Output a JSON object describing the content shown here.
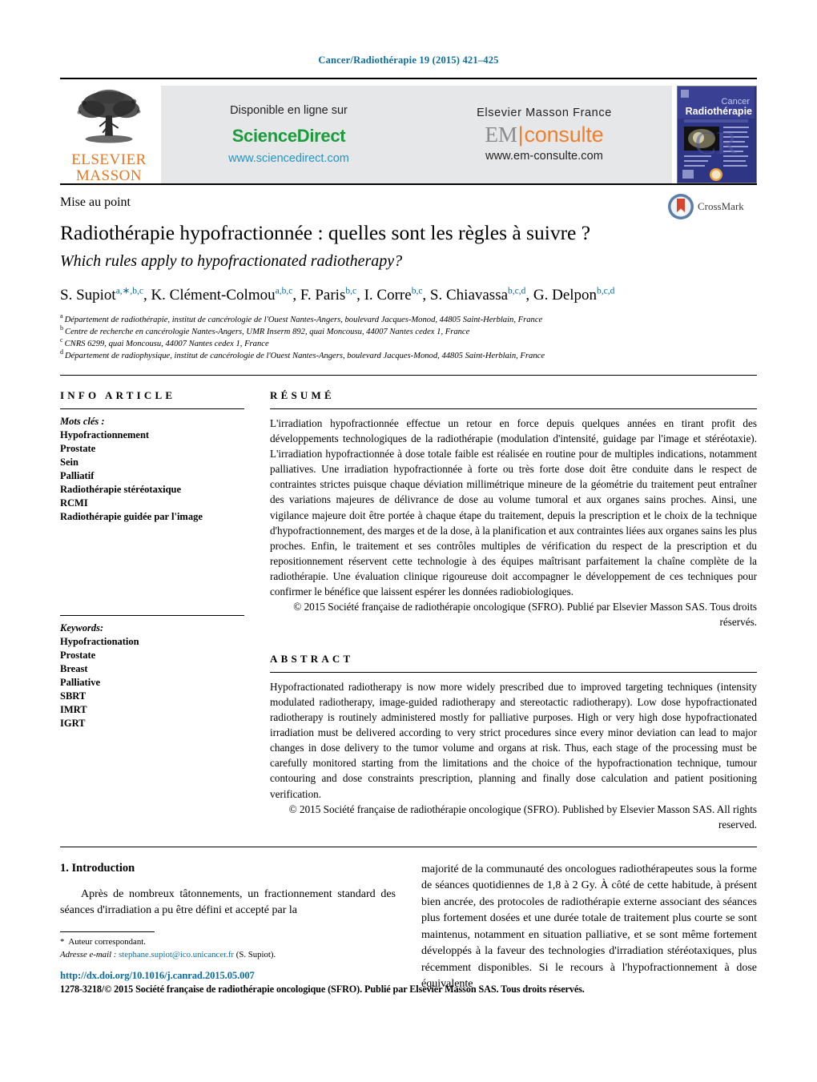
{
  "running_head": "Cancer/Radiothérapie 19 (2015) 421–425",
  "masthead": {
    "publisher_line1": "ELSEVIER",
    "publisher_line2": "MASSON",
    "available_label": "Disponible en ligne sur",
    "sciencedirect_logo": "ScienceDirect",
    "sciencedirect_url": "www.sciencedirect.com",
    "em_label": "Elsevier Masson France",
    "em_logo_grey": "EM",
    "em_logo_orange": "consulte",
    "em_url": "www.em-consulte.com",
    "cover_title_line1": "Cancer",
    "cover_title_line2": "Radiothérapie"
  },
  "article": {
    "type": "Mise au point",
    "title_fr": "Radiothérapie hypofractionnée : quelles sont les règles à suivre ?",
    "title_en": "Which rules apply to hypofractionated radiotherapy?",
    "crossmark_label": "CrossMark",
    "authors": [
      {
        "name": "S. Supiot",
        "sup": "a,∗,b,c",
        "sep": ", "
      },
      {
        "name": "K. Clément-Colmou",
        "sup": "a,b,c",
        "sep": ", "
      },
      {
        "name": "F. Paris",
        "sup": "b,c",
        "sep": ", "
      },
      {
        "name": "I. Corre",
        "sup": "b,c",
        "sep": ", "
      },
      {
        "name": "S. Chiavassa",
        "sup": "b,c,d",
        "sep": ", "
      },
      {
        "name": "G. Delpon",
        "sup": "b,c,d",
        "sep": ""
      }
    ],
    "affiliations": [
      {
        "mark": "a",
        "text": "Département de radiothérapie, institut de cancérologie de l'Ouest Nantes-Angers, boulevard Jacques-Monod, 44805 Saint-Herblain, France"
      },
      {
        "mark": "b",
        "text": "Centre de recherche en cancérologie Nantes-Angers, UMR Inserm 892, quai Moncousu, 44007 Nantes cedex 1, France"
      },
      {
        "mark": "c",
        "text": "CNRS 6299, quai Moncousu, 44007 Nantes cedex 1, France"
      },
      {
        "mark": "d",
        "text": "Département de radiophysique, institut de cancérologie de l'Ouest Nantes-Angers, boulevard Jacques-Monod, 44805 Saint-Herblain, France"
      }
    ]
  },
  "info_article": {
    "heading": "INFO ARTICLE",
    "keywords_title": "Mots clés :",
    "keywords": [
      "Hypofractionnement",
      "Prostate",
      "Sein",
      "Palliatif",
      "Radiothérapie stéréotaxique",
      "RCMI",
      "Radiothérapie guidée par l'image"
    ]
  },
  "keywords_en": {
    "keywords_title": "Keywords:",
    "keywords": [
      "Hypofractionation",
      "Prostate",
      "Breast",
      "Palliative",
      "SBRT",
      "IMRT",
      "IGRT"
    ]
  },
  "resume": {
    "heading": "RÉSUMÉ",
    "text": "L'irradiation hypofractionnée effectue un retour en force depuis quelques années en tirant profit des développements technologiques de la radiothérapie (modulation d'intensité, guidage par l'image et stéréotaxie). L'irradiation hypofractionnée à dose totale faible est réalisée en routine pour de multiples indications, notamment palliatives. Une irradiation hypofractionnée à forte ou très forte dose doit être conduite dans le respect de contraintes strictes puisque chaque déviation millimétrique mineure de la géométrie du traitement peut entraîner des variations majeures de délivrance de dose au volume tumoral et aux organes sains proches. Ainsi, une vigilance majeure doit être portée à chaque étape du traitement, depuis la prescription et le choix de la technique d'hypofractionnement, des marges et de la dose, à la planification et aux contraintes liées aux organes sains les plus proches. Enfin, le traitement et ses contrôles multiples de vérification du respect de la prescription et du repositionnement réservent cette technologie à des équipes maîtrisant parfaitement la chaîne complète de la radiothérapie. Une évaluation clinique rigoureuse doit accompagner le développement de ces techniques pour confirmer le bénéfice que laissent espérer les données radiobiologiques.",
    "copyright": "© 2015 Société française de radiothérapie oncologique (SFRO). Publié par Elsevier Masson SAS. Tous droits réservés."
  },
  "abstract": {
    "heading": "ABSTRACT",
    "text": "Hypofractionated radiotherapy is now more widely prescribed due to improved targeting techniques (intensity modulated radiotherapy, image-guided radiotherapy and stereotactic radiotherapy). Low dose hypofractionated radiotherapy is routinely administered mostly for palliative purposes. High or very high dose hypofractionated irradiation must be delivered according to very strict procedures since every minor deviation can lead to major changes in dose delivery to the tumor volume and organs at risk. Thus, each stage of the processing must be carefully monitored starting from the limitations and the choice of the hypofractionation technique, tumour contouring and dose constraints prescription, planning and finally dose calculation and patient positioning verification.",
    "copyright": "© 2015 Société française de radiothérapie oncologique (SFRO). Published by Elsevier Masson SAS. All rights reserved."
  },
  "body": {
    "section_title": "1. Introduction",
    "left_paragraph": "Après de nombreux tâtonnements, un fractionnement standard des séances d'irradiation a pu être défini et accepté par la",
    "right_paragraph": "majorité de la communauté des oncologues radiothérapeutes sous la forme de séances quotidiennes de 1,8 à 2 Gy. À côté de cette habitude, à présent bien ancrée, des protocoles de radiothérapie externe associant des séances plus fortement dosées et une durée totale de traitement plus courte se sont maintenus, notamment en situation palliative, et se sont même fortement développés à la faveur des technologies d'irradiation stéréotaxiques, plus récemment disponibles. Si le recours à l'hypofractionnement à dose équivalente"
  },
  "footnotes": {
    "corresponding_star": "*",
    "corresponding_label": "Auteur correspondant.",
    "email_label": "Adresse e-mail :",
    "email": "stephane.supiot@ico.unicancer.fr",
    "email_suffix": "(S. Supiot)."
  },
  "footer": {
    "doi": "http://dx.doi.org/10.1016/j.canrad.2015.05.007",
    "issn_line": "1278-3218/© 2015 Société française de radiothérapie oncologique (SFRO). Publié par Elsevier Masson SAS. Tous droits réservés."
  },
  "colors": {
    "link_blue": "#0b6ca0",
    "sciencedirect_green": "#1a9c3c",
    "elsevier_orange": "#e87722",
    "banner_grey": "#e6e7e8"
  }
}
